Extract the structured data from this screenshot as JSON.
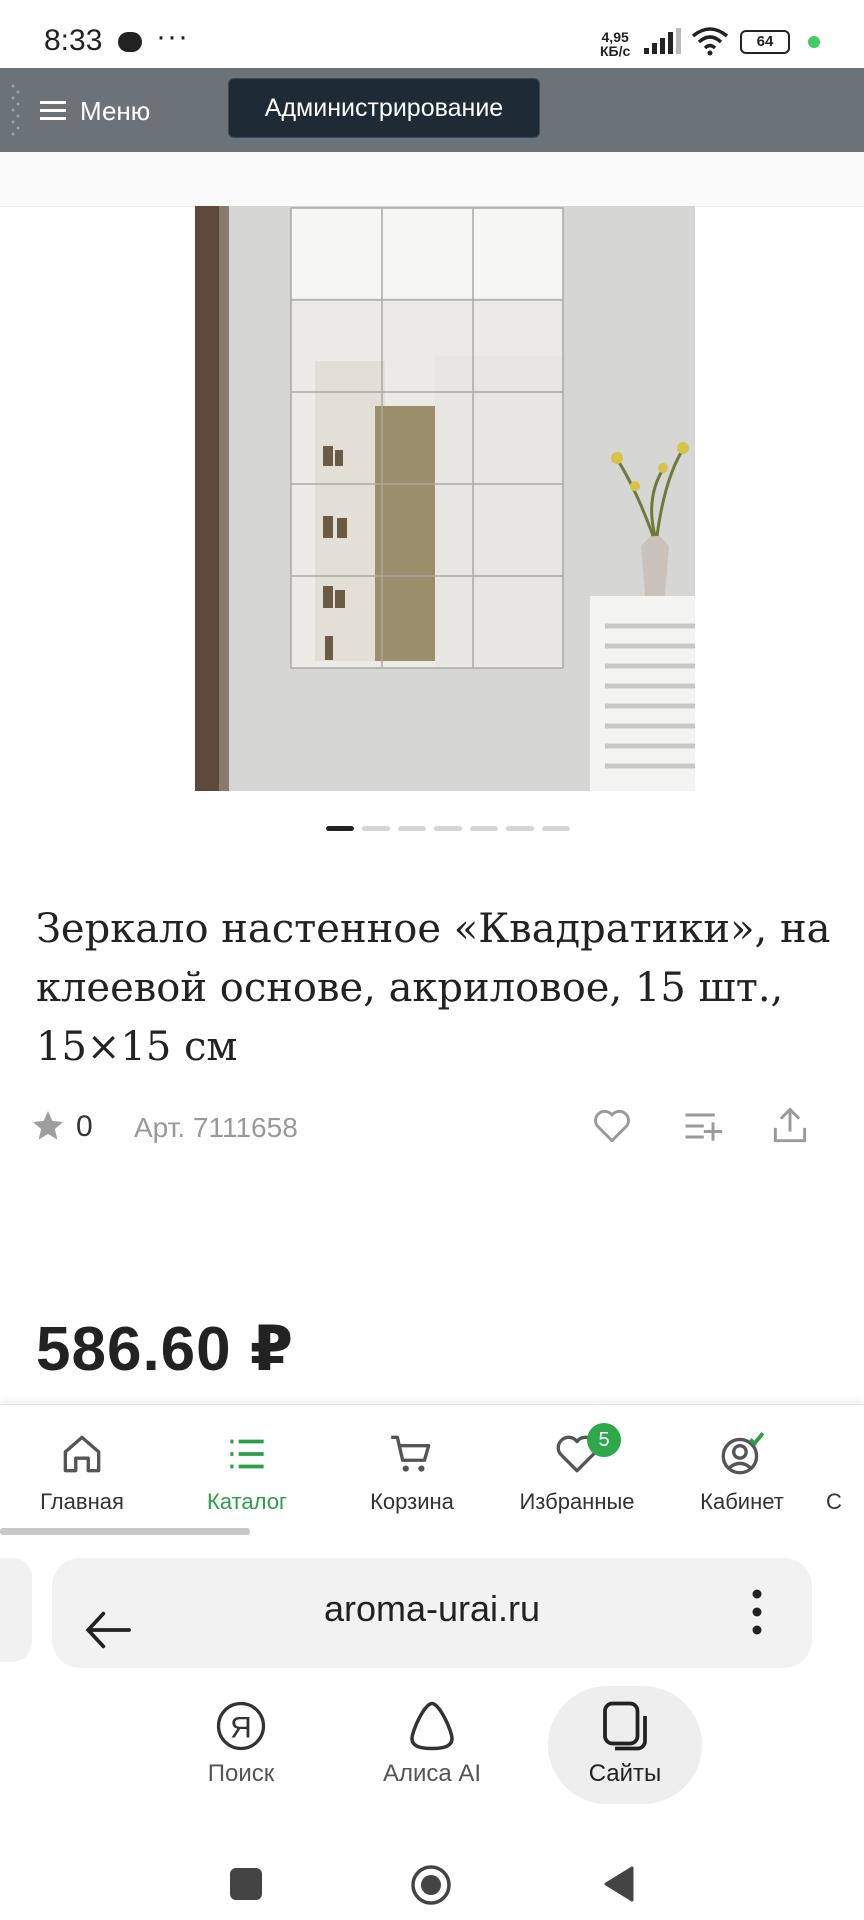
{
  "status_bar": {
    "time": "8:33",
    "speed_value": "4,95",
    "speed_unit": "КБ/с",
    "battery": "64"
  },
  "admin_bar": {
    "menu_label": "Меню",
    "admin_label": "Администрирование"
  },
  "product": {
    "title": "Зеркало настенное «Квадратики», на клеевой основе, акриловое, 15 шт., 15×15 см",
    "rating_count": "0",
    "article": "Арт. 7111658",
    "price": "586.60 ₽",
    "gallery_pages": 7,
    "gallery_active": 1
  },
  "bottom_nav": {
    "items": [
      {
        "label": "Главная",
        "icon": "home-icon"
      },
      {
        "label": "Каталог",
        "icon": "list-icon"
      },
      {
        "label": "Корзина",
        "icon": "cart-icon"
      },
      {
        "label": "Избранные",
        "icon": "heart-icon"
      },
      {
        "label": "Кабинет",
        "icon": "user-icon"
      },
      {
        "label": "С",
        "icon": "more-icon"
      }
    ],
    "favorites_badge": "5",
    "active_index": 1
  },
  "browser": {
    "url": "aroma-urai.ru"
  },
  "yandex_bar": {
    "items": [
      {
        "label": "Поиск",
        "icon": "yandex-search-icon"
      },
      {
        "label": "Алиса AI",
        "icon": "alice-icon"
      },
      {
        "label": "Сайты",
        "icon": "tabs-icon"
      }
    ]
  },
  "colors": {
    "accent_green": "#2e9e4a",
    "admin_bar": "#6b7379",
    "admin_button": "#1e2a36"
  }
}
